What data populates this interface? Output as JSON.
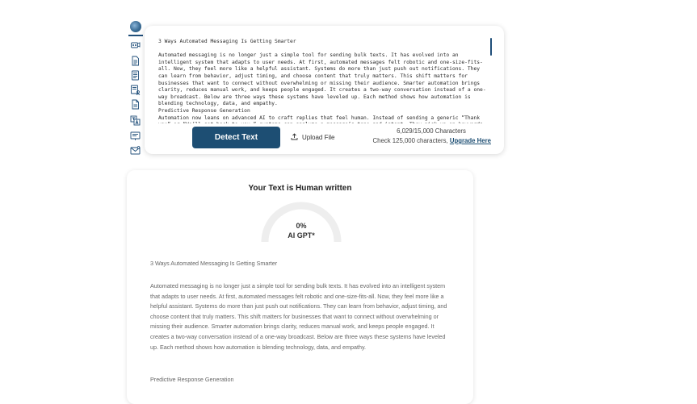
{
  "sidebar": {
    "icons": [
      "globe-logo-icon",
      "chat-bot-icon",
      "document-icon",
      "document-list-icon",
      "document-user-icon",
      "document-edit-icon",
      "translate-icon",
      "slides-icon",
      "mail-icon"
    ]
  },
  "editor": {
    "title": "3 Ways Automated Messaging Is Getting Smarter",
    "paragraph1": "Automated messaging is no longer just a simple tool for sending bulk texts. It has evolved into an intelligent system that adapts to user needs. At first, automated messages felt robotic and one-size-fits-all. Now, they feel more like a helpful assistant. Systems do more than just push out notifications. They can learn from behavior, adjust timing, and choose content that truly matters. This shift matters for businesses that want to connect without overwhelming or missing their audience. Smarter automation brings clarity, reduces manual work, and keeps people engaged. It creates a two-way conversation instead of a one-way broadcast. Below are three ways these systems have leveled up. Each method shows how automation is blending technology, data, and empathy.",
    "subheading": "Predictive Response Generation",
    "paragraph2": "Automation now leans on advanced AI to craft replies that feel human. Instead of sending a generic “Thank you” or “We’ll get back to you,” systems can analyze a message’s tone and intent. They pick up on keywords and sentiment. Then, the platform builds a reply that matches. For example, if someone asks about a late delivery,",
    "detect_button": "Detect Text",
    "upload_button": "Upload File",
    "char_count": "6,029/15,000 Characters",
    "char_check": "Check 125,000 characters,",
    "upgrade_link": "Upgrade Here"
  },
  "result": {
    "heading": "Your Text is Human written",
    "ai_percent": "0%",
    "ai_label": "AI GPT*",
    "ai_fraction": 0,
    "doc_title": "3 Ways Automated Messaging Is Getting Smarter",
    "body": "Automated messaging is no longer just a simple tool for sending bulk texts. It has evolved into an intelligent system that adapts to user needs. At first, automated messages felt robotic and one-size-fits-all. Now, they feel more like a helpful assistant. Systems do more than just push out notifications. They can learn from behavior, adjust timing, and choose content that truly matters. This shift matters for businesses that want to connect without overwhelming or missing their audience. Smarter automation brings clarity, reduces manual work, and keeps people engaged. It creates a two-way conversation instead of a one-way broadcast. Below are three ways these systems have leveled up. Each method shows how automation is blending technology, data, and empathy.",
    "subheading": "Predictive Response Generation"
  },
  "colors": {
    "primary": "#1d4e73",
    "gauge_track": "#eeeeee",
    "text_muted": "#666666"
  }
}
